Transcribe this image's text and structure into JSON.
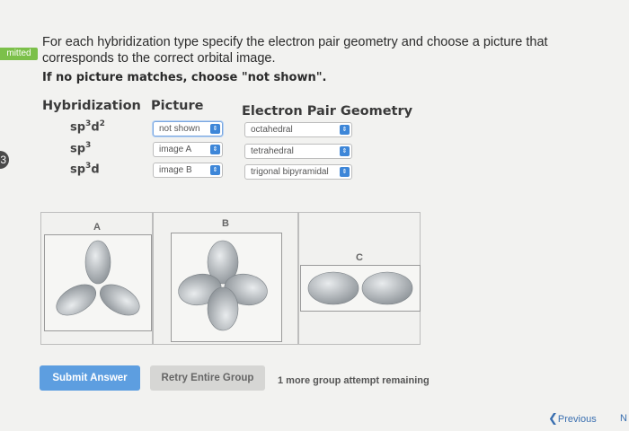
{
  "side": {
    "tag": "mitted",
    "circle": "3"
  },
  "question": {
    "line1": "For each hybridization type specify the electron pair geometry and choose a picture that corresponds to the correct orbital image.",
    "note": "If no picture matches, choose \"not shown\"."
  },
  "table": {
    "headers": {
      "hybridization": "Hybridization",
      "picture": "Picture",
      "geometry": "Electron Pair Geometry"
    },
    "rows": [
      {
        "hyb": "sp",
        "sup1": "3",
        "mid": "d",
        "sup2": "2",
        "picture": "not shown",
        "geometry": "octahedral"
      },
      {
        "hyb": "sp",
        "sup1": "3",
        "mid": "",
        "sup2": "",
        "picture": "image A",
        "geometry": "tetrahedral"
      },
      {
        "hyb": "sp",
        "sup1": "3",
        "mid": "d",
        "sup2": "",
        "picture": "image B",
        "geometry": "trigonal bipyramidal"
      }
    ]
  },
  "images": {
    "a": "A",
    "b": "B",
    "c": "C"
  },
  "buttons": {
    "submit": "Submit Answer",
    "retry": "Retry Entire Group"
  },
  "remaining": "1 more group attempt remaining",
  "nav": {
    "previous": "Previous",
    "next_partial": "N"
  },
  "colors": {
    "accent": "#3d86d8",
    "submit": "#5d9ee0",
    "tag": "#7cc04a"
  }
}
